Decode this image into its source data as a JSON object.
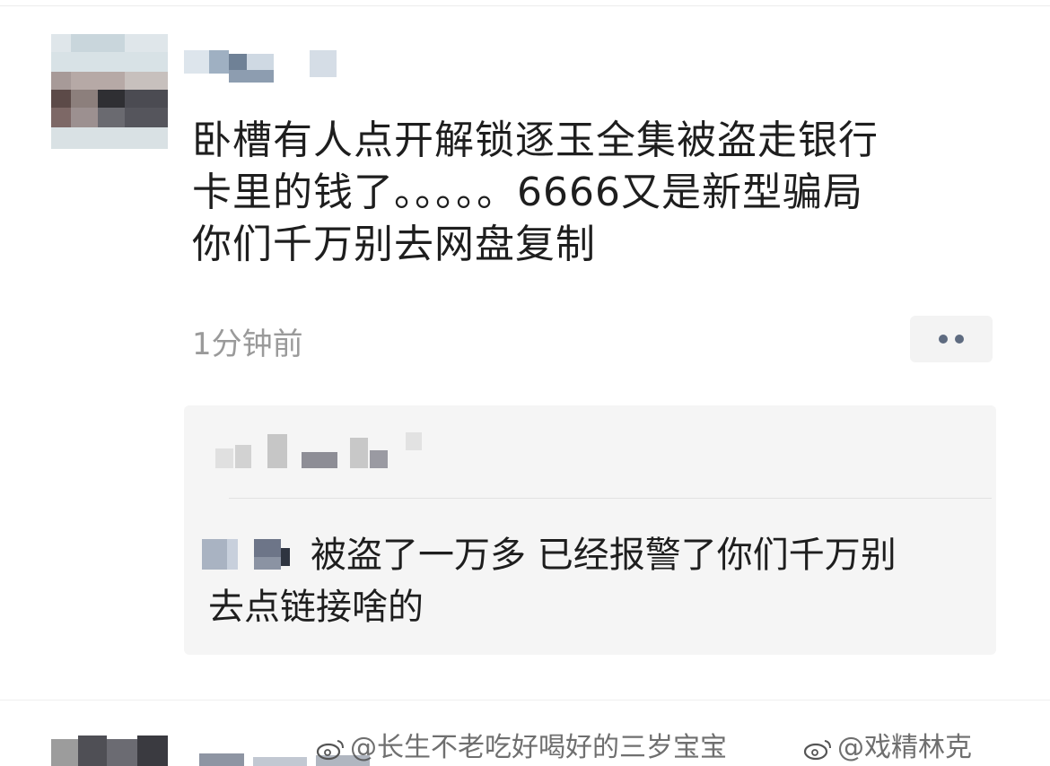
{
  "post": {
    "text_lines": [
      "卧槽有人点开解锁逐玉全集被盗走银行",
      "卡里的钱了。。。。。6666又是新型骗局",
      "你们千万别去网盘复制"
    ],
    "time": "1分钟前",
    "more_icon": "more-dots-icon"
  },
  "comment": {
    "text_line1": "被盗了一万多 已经报警了你们千万别",
    "text_line2": "去点链接啥的"
  },
  "watermarks": {
    "left": "@长生不老吃好喝好的三岁宝宝",
    "right": "@戏精林克",
    "icon": "weibo-icon"
  },
  "colors": {
    "text": "#1e1e1e",
    "time": "#9a9a9a",
    "comment_bg": "#f5f5f5",
    "dots": "#5e6b80"
  }
}
